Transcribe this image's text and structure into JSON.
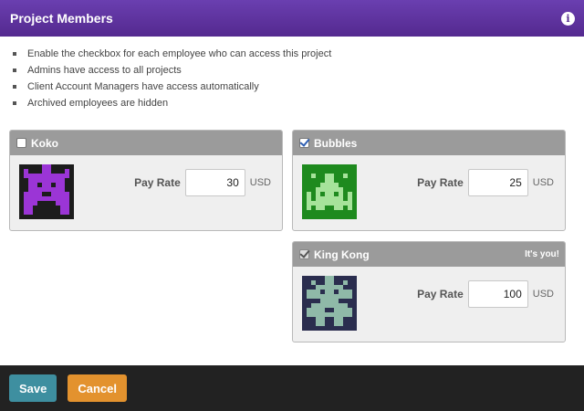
{
  "header": {
    "title": "Project Members",
    "info_icon": "info-icon"
  },
  "notes": [
    "Enable the checkbox for each employee who can access this project",
    "Admins have access to all projects",
    "Client Account Managers have access automatically",
    "Archived employees are hidden"
  ],
  "members": [
    {
      "name": "Koko",
      "checked": false,
      "disabled": false,
      "rate_label": "Pay Rate",
      "rate": "30",
      "unit": "USD",
      "badge": "",
      "avatar_bg": "#1c1c1c",
      "avatar_fg": "#9b35d6"
    },
    {
      "name": "Bubbles",
      "checked": true,
      "disabled": false,
      "rate_label": "Pay Rate",
      "rate": "25",
      "unit": "USD",
      "badge": "",
      "avatar_bg": "#1e8a1e",
      "avatar_fg": "#a6e39a"
    },
    {
      "name": "King Kong",
      "checked": true,
      "disabled": true,
      "rate_label": "Pay Rate",
      "rate": "100",
      "unit": "USD",
      "badge": "It's you!",
      "avatar_bg": "#2a2d4e",
      "avatar_fg": "#8fb9a8"
    }
  ],
  "footer": {
    "save_label": "Save",
    "cancel_label": "Cancel"
  },
  "colors": {
    "header": "#5b2f9a",
    "save": "#3e8fa0",
    "cancel": "#e3922e",
    "footer": "#222222"
  }
}
